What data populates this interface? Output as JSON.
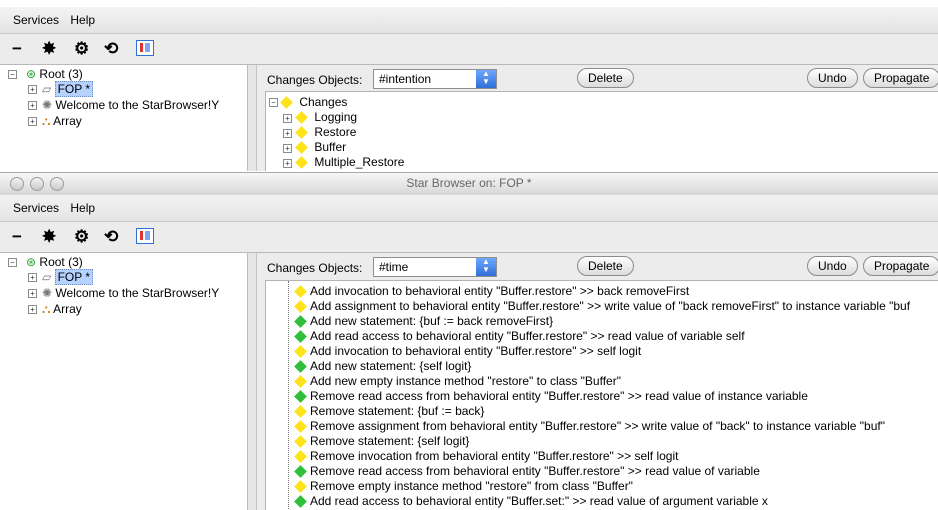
{
  "top": {
    "menu": {
      "items": [
        "Services",
        "Help"
      ]
    },
    "toolbar": {
      "icons": [
        "minus-icon",
        "splash-icon",
        "gear-icon",
        "rotate-icon",
        "window-icon"
      ]
    },
    "tree": [
      {
        "label": "Root (3)",
        "level": 0,
        "icon": "root-icon"
      },
      {
        "label": "FOP *",
        "level": 1,
        "icon": "folder-icon",
        "selected": true
      },
      {
        "label": "Welcome to the StarBrowser!Y",
        "level": 1,
        "icon": "gear-icon"
      },
      {
        "label": "Array",
        "level": 1,
        "icon": "array-icon"
      }
    ],
    "changes_label": "Changes Objects:",
    "changes_select": "#intention",
    "buttons": {
      "delete": "Delete",
      "undo": "Undo",
      "propagate": "Propagate"
    },
    "changes_tree": {
      "root": "Changes",
      "children": [
        "Logging",
        "Restore",
        "Buffer",
        "Multiple_Restore"
      ]
    }
  },
  "window_title": "Star Browser on: FOP *",
  "bottom": {
    "menu": {
      "items": [
        "Services",
        "Help"
      ]
    },
    "toolbar": {
      "icons": [
        "minus-icon",
        "splash-icon",
        "gear-icon",
        "rotate-icon",
        "window-icon"
      ]
    },
    "tree": [
      {
        "label": "Root (3)",
        "level": 0,
        "icon": "root-icon"
      },
      {
        "label": "FOP *",
        "level": 1,
        "icon": "folder-icon",
        "selected": true
      },
      {
        "label": "Welcome to the StarBrowser!Y",
        "level": 1,
        "icon": "gear-icon"
      },
      {
        "label": "Array",
        "level": 1,
        "icon": "array-icon"
      }
    ],
    "changes_label": "Changes Objects:",
    "changes_select": "#time",
    "buttons": {
      "delete": "Delete",
      "undo": "Undo",
      "propagate": "Propagate"
    },
    "changes": [
      {
        "text": "Add invocation to behavioral entity \"Buffer.restore\" >> back removeFirst",
        "color": "yellow"
      },
      {
        "text": "Add assignment to behavioral entity \"Buffer.restore\" >> write value of \"back removeFirst\" to instance variable \"buf",
        "color": "yellow"
      },
      {
        "text": "Add new statement: {buf := back removeFirst}",
        "color": "green"
      },
      {
        "text": "Add read access to behavioral entity \"Buffer.restore\" >> read value of  variable self",
        "color": "green"
      },
      {
        "text": "Add invocation to behavioral entity \"Buffer.restore\" >> self logit",
        "color": "yellow"
      },
      {
        "text": "Add new statement: {self logit}",
        "color": "green"
      },
      {
        "text": "Add new empty instance method \"restore\" to class \"Buffer\"",
        "color": "yellow"
      },
      {
        "text": "Remove read access from behavioral entity \"Buffer.restore\" >> read value of instance variable",
        "color": "green"
      },
      {
        "text": "Remove statement: {buf := back}",
        "color": "yellow"
      },
      {
        "text": "Remove assignment from behavioral entity \"Buffer.restore\" >> write value of \"back\" to instance variable \"buf\"",
        "color": "yellow"
      },
      {
        "text": "Remove statement: {self logit}",
        "color": "yellow"
      },
      {
        "text": "Remove invocation from behavioral entity \"Buffer.restore\" >> self logit",
        "color": "yellow"
      },
      {
        "text": "Remove read access from behavioral entity \"Buffer.restore\" >> read value of  variable",
        "color": "green"
      },
      {
        "text": "Remove empty instance method \"restore\" from class \"Buffer\"",
        "color": "yellow"
      },
      {
        "text": "Add read access to behavioral entity \"Buffer.set:\" >> read value of argument variable x",
        "color": "green"
      }
    ]
  },
  "colors": {
    "yellow": "#ffe31a",
    "green": "#2fbf3a",
    "selection": "#b6d3ff",
    "accent": "#2f6fd8"
  }
}
